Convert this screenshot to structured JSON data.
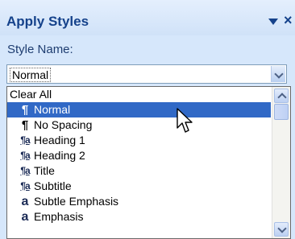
{
  "pane": {
    "title": "Apply Styles",
    "menu_icon": "dropdown-arrow-icon",
    "close_glyph": "×"
  },
  "style_name": {
    "label": "Style Name:",
    "value": "Normal"
  },
  "list": {
    "items": [
      {
        "label": "Clear All",
        "icon": "none",
        "selected": false
      },
      {
        "label": "Normal",
        "icon": "paragraph-style-icon",
        "glyph": "¶",
        "selected": true
      },
      {
        "label": "No Spacing",
        "icon": "paragraph-style-icon",
        "glyph": "¶",
        "selected": false
      },
      {
        "label": "Heading 1",
        "icon": "linked-style-icon",
        "glyph": "¶a",
        "selected": false
      },
      {
        "label": "Heading 2",
        "icon": "linked-style-icon",
        "glyph": "¶a",
        "selected": false
      },
      {
        "label": "Title",
        "icon": "linked-style-icon",
        "glyph": "¶a",
        "selected": false
      },
      {
        "label": "Subtitle",
        "icon": "linked-style-icon",
        "glyph": "¶a",
        "selected": false
      },
      {
        "label": "Subtle Emphasis",
        "icon": "character-style-icon",
        "glyph": "a",
        "selected": false
      },
      {
        "label": "Emphasis",
        "icon": "character-style-icon",
        "glyph": "a",
        "selected": false
      }
    ]
  },
  "colors": {
    "pane_bg": "#d6e7fb",
    "title_text": "#15428b",
    "selection": "#3169c6"
  }
}
